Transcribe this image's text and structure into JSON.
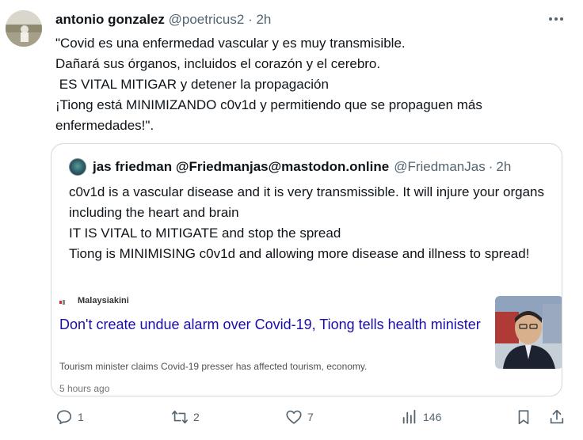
{
  "tweet": {
    "author_name": "antonio gonzalez",
    "author_handle": "@poetricus2",
    "separator": "·",
    "time": "2h",
    "text": "\"Covid es una enfermedad vascular y es muy transmisible.\nDañará sus órganos, incluidos el corazón y el cerebro.\n ES VITAL MITIGAR y detener la propagación\n¡Tiong está MINIMIZANDO c0v1d y permitiendo que se propaguen más enfermedades!\"."
  },
  "quote": {
    "author_name": "jas friedman @Friedmanjas@mastodon.online",
    "author_handle": "@FriedmanJas",
    "separator": "·",
    "time": "2h",
    "text": "c0v1d is a vascular disease and it is very transmissible. It will injure your organs including the heart and brain\nIT IS VITAL to MITIGATE and stop the spread\nTiong is MINIMISING c0v1d and allowing more disease and illness to spread!"
  },
  "card": {
    "source": "Malaysiakini",
    "title": "Don't create undue alarm over Covid-19, Tiong tells health minister",
    "description": "Tourism minister claims Covid-19 presser has affected tourism, economy.",
    "time": "5 hours ago"
  },
  "actions": {
    "replies": "1",
    "reposts": "2",
    "likes": "7",
    "views": "146"
  },
  "colors": {
    "text": "#0f1419",
    "secondary": "#536471",
    "link": "#1a0dab",
    "border": "#cfd9de"
  }
}
